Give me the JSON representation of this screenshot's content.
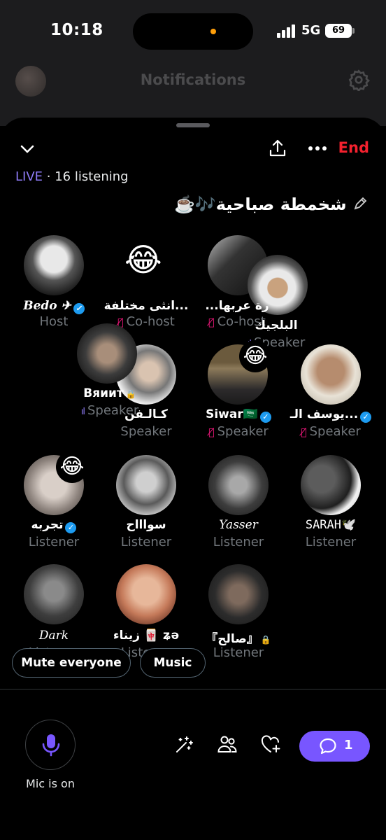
{
  "status_bar": {
    "time": "10:18",
    "network": "5G",
    "battery": "69"
  },
  "background_header": {
    "title": "Notifications"
  },
  "space": {
    "live_label": "LIVE",
    "listening_text": " · 16 listening",
    "end_label": "End",
    "title": "شخمطة صباحية🎶☕️",
    "title_icon": "pencil-icon"
  },
  "participants": [
    {
      "name": "Bedo ✈︎",
      "role": "Host",
      "verified": true
    },
    {
      "name": "انثى مختلفة...",
      "role": "Co-host",
      "muted": true,
      "emoji": "😂"
    },
    {
      "name": "...رة عربها",
      "role": "Co-host",
      "muted": true
    },
    {
      "name": "البلجيك",
      "role": "Speaker",
      "speaking": true
    },
    {
      "name": "Вяиит",
      "role": "Speaker",
      "speaking": true,
      "locked": true
    },
    {
      "name": "كـالـفن",
      "role": "Speaker"
    },
    {
      "name": "Siwar🇸🇦",
      "role": "Speaker",
      "muted": true,
      "verified": true,
      "emoji": "😂"
    },
    {
      "name": "يوسف الـ...",
      "role": "Speaker",
      "muted": true,
      "verified": true
    },
    {
      "name": "تجربه",
      "role": "Listener",
      "verified": true,
      "emoji": "😂"
    },
    {
      "name": "سواااح",
      "role": "Listener"
    },
    {
      "name": "Yasser",
      "role": "Listener"
    },
    {
      "name": "SARAH🕊️",
      "role": "Listener"
    },
    {
      "name": "Dark",
      "role": "Listener"
    },
    {
      "name": "زيناء 🀄 ʑә",
      "role": "Listener"
    },
    {
      "name": "『صالح』",
      "role": "Listener",
      "locked": true
    }
  ],
  "actions": {
    "mute_everyone": "Mute everyone",
    "music": "Music"
  },
  "bottom_bar": {
    "mic_label": "Mic is on",
    "reply_count": "1"
  },
  "colors": {
    "live": "#8f7cf7",
    "end": "#f4212e",
    "mute": "#f91880",
    "accent": "#7856ff",
    "verified": "#1d9bf0"
  }
}
